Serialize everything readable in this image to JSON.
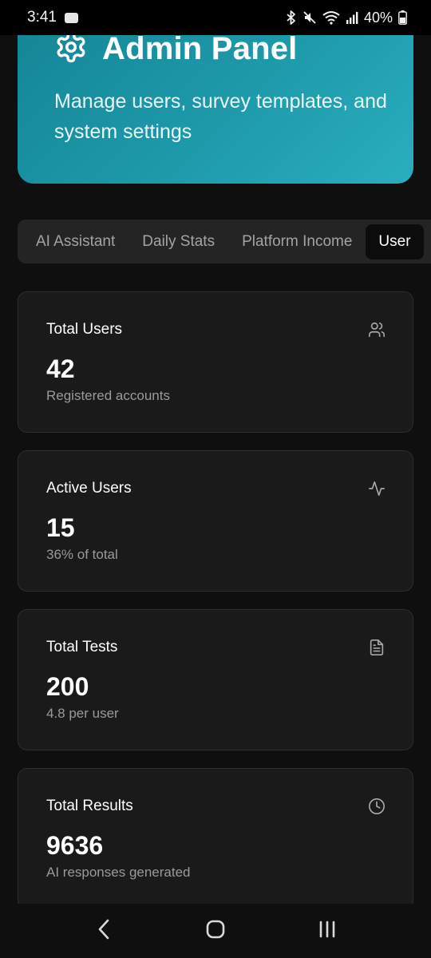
{
  "status_bar": {
    "time": "3:41",
    "app_badge": "Wear",
    "battery": "40%",
    "icons": [
      "bluetooth-icon",
      "mute-icon",
      "wifi-icon",
      "signal-icon",
      "battery-icon"
    ]
  },
  "header": {
    "title": "Admin Panel",
    "subtitle": "Manage users, survey templates, and system settings",
    "icon": "gear-icon",
    "gradient": [
      "#148696",
      "#2aaebe"
    ]
  },
  "tabs": [
    {
      "label": "AI Assistant",
      "active": false
    },
    {
      "label": "Daily Stats",
      "active": false
    },
    {
      "label": "Platform Income",
      "active": false
    },
    {
      "label": "User",
      "active": true
    }
  ],
  "stats": [
    {
      "title": "Total Users",
      "value": "42",
      "subtitle": "Registered accounts",
      "icon": "users-icon"
    },
    {
      "title": "Active Users",
      "value": "15",
      "subtitle": "36% of total",
      "icon": "activity-icon"
    },
    {
      "title": "Total Tests",
      "value": "200",
      "subtitle": "4.8 per user",
      "icon": "document-icon"
    },
    {
      "title": "Total Results",
      "value": "9636",
      "subtitle": "AI responses generated",
      "icon": "clock-icon"
    }
  ],
  "nav": [
    "back-icon",
    "home-icon",
    "recents-icon"
  ]
}
